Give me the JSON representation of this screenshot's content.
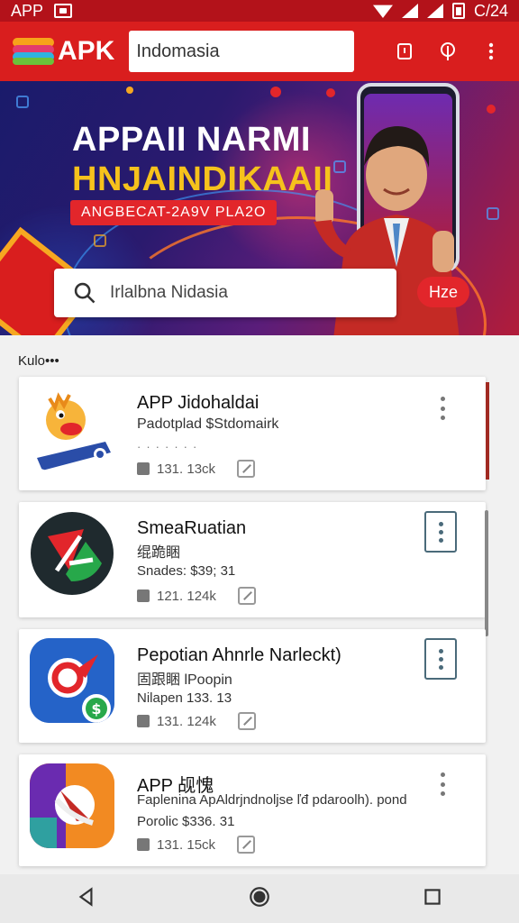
{
  "status_bar": {
    "left_text": "APP",
    "right_text": "C/24"
  },
  "app_bar": {
    "logo_text": "APK",
    "search_value": "Indomasia",
    "icons": [
      "notification-icon",
      "location-icon",
      "more-icon"
    ]
  },
  "banner": {
    "title_line1": "APPAII NARMI",
    "title_line2": "HNJAINDIKAAII",
    "pill_text": "ANGBECAT-2A9V PLA2O",
    "search_value": "Irlalbna Nidasia",
    "go_label": "Hze"
  },
  "section": {
    "label": "Kulo•••"
  },
  "apps": [
    {
      "title": "APP Jidohaldai",
      "subtitle": "Padotplad $Stdomairk",
      "meta": "131. 13ck",
      "colors": {
        "bg": "#f7b43a",
        "accent": "#2a4da8"
      }
    },
    {
      "title": "SmeaRuatian",
      "subtitle": "绲跪睏",
      "line2": "Snades: $39; 31",
      "meta": "121. 124k",
      "colors": {
        "bg": "#1f2a2e",
        "accent": "#e2262b"
      }
    },
    {
      "title": "Pepotian Ahnrle Narleckt)",
      "subtitle": "固跟睏 lPoopin",
      "line2": "Nilapen 133. 13",
      "meta": "131. 124k",
      "colors": {
        "bg": "#2563c8",
        "accent": "#27a84a"
      }
    },
    {
      "title": "APP 觇愧",
      "subtitle": "Faplenina ApAldrjndnoljse ľđ pdaroolh). pond",
      "line2": "Porolic $336. 31",
      "meta": "131. 15ck",
      "colors": {
        "bg": "#f28a22",
        "accent": "#6a2bb0"
      }
    }
  ]
}
